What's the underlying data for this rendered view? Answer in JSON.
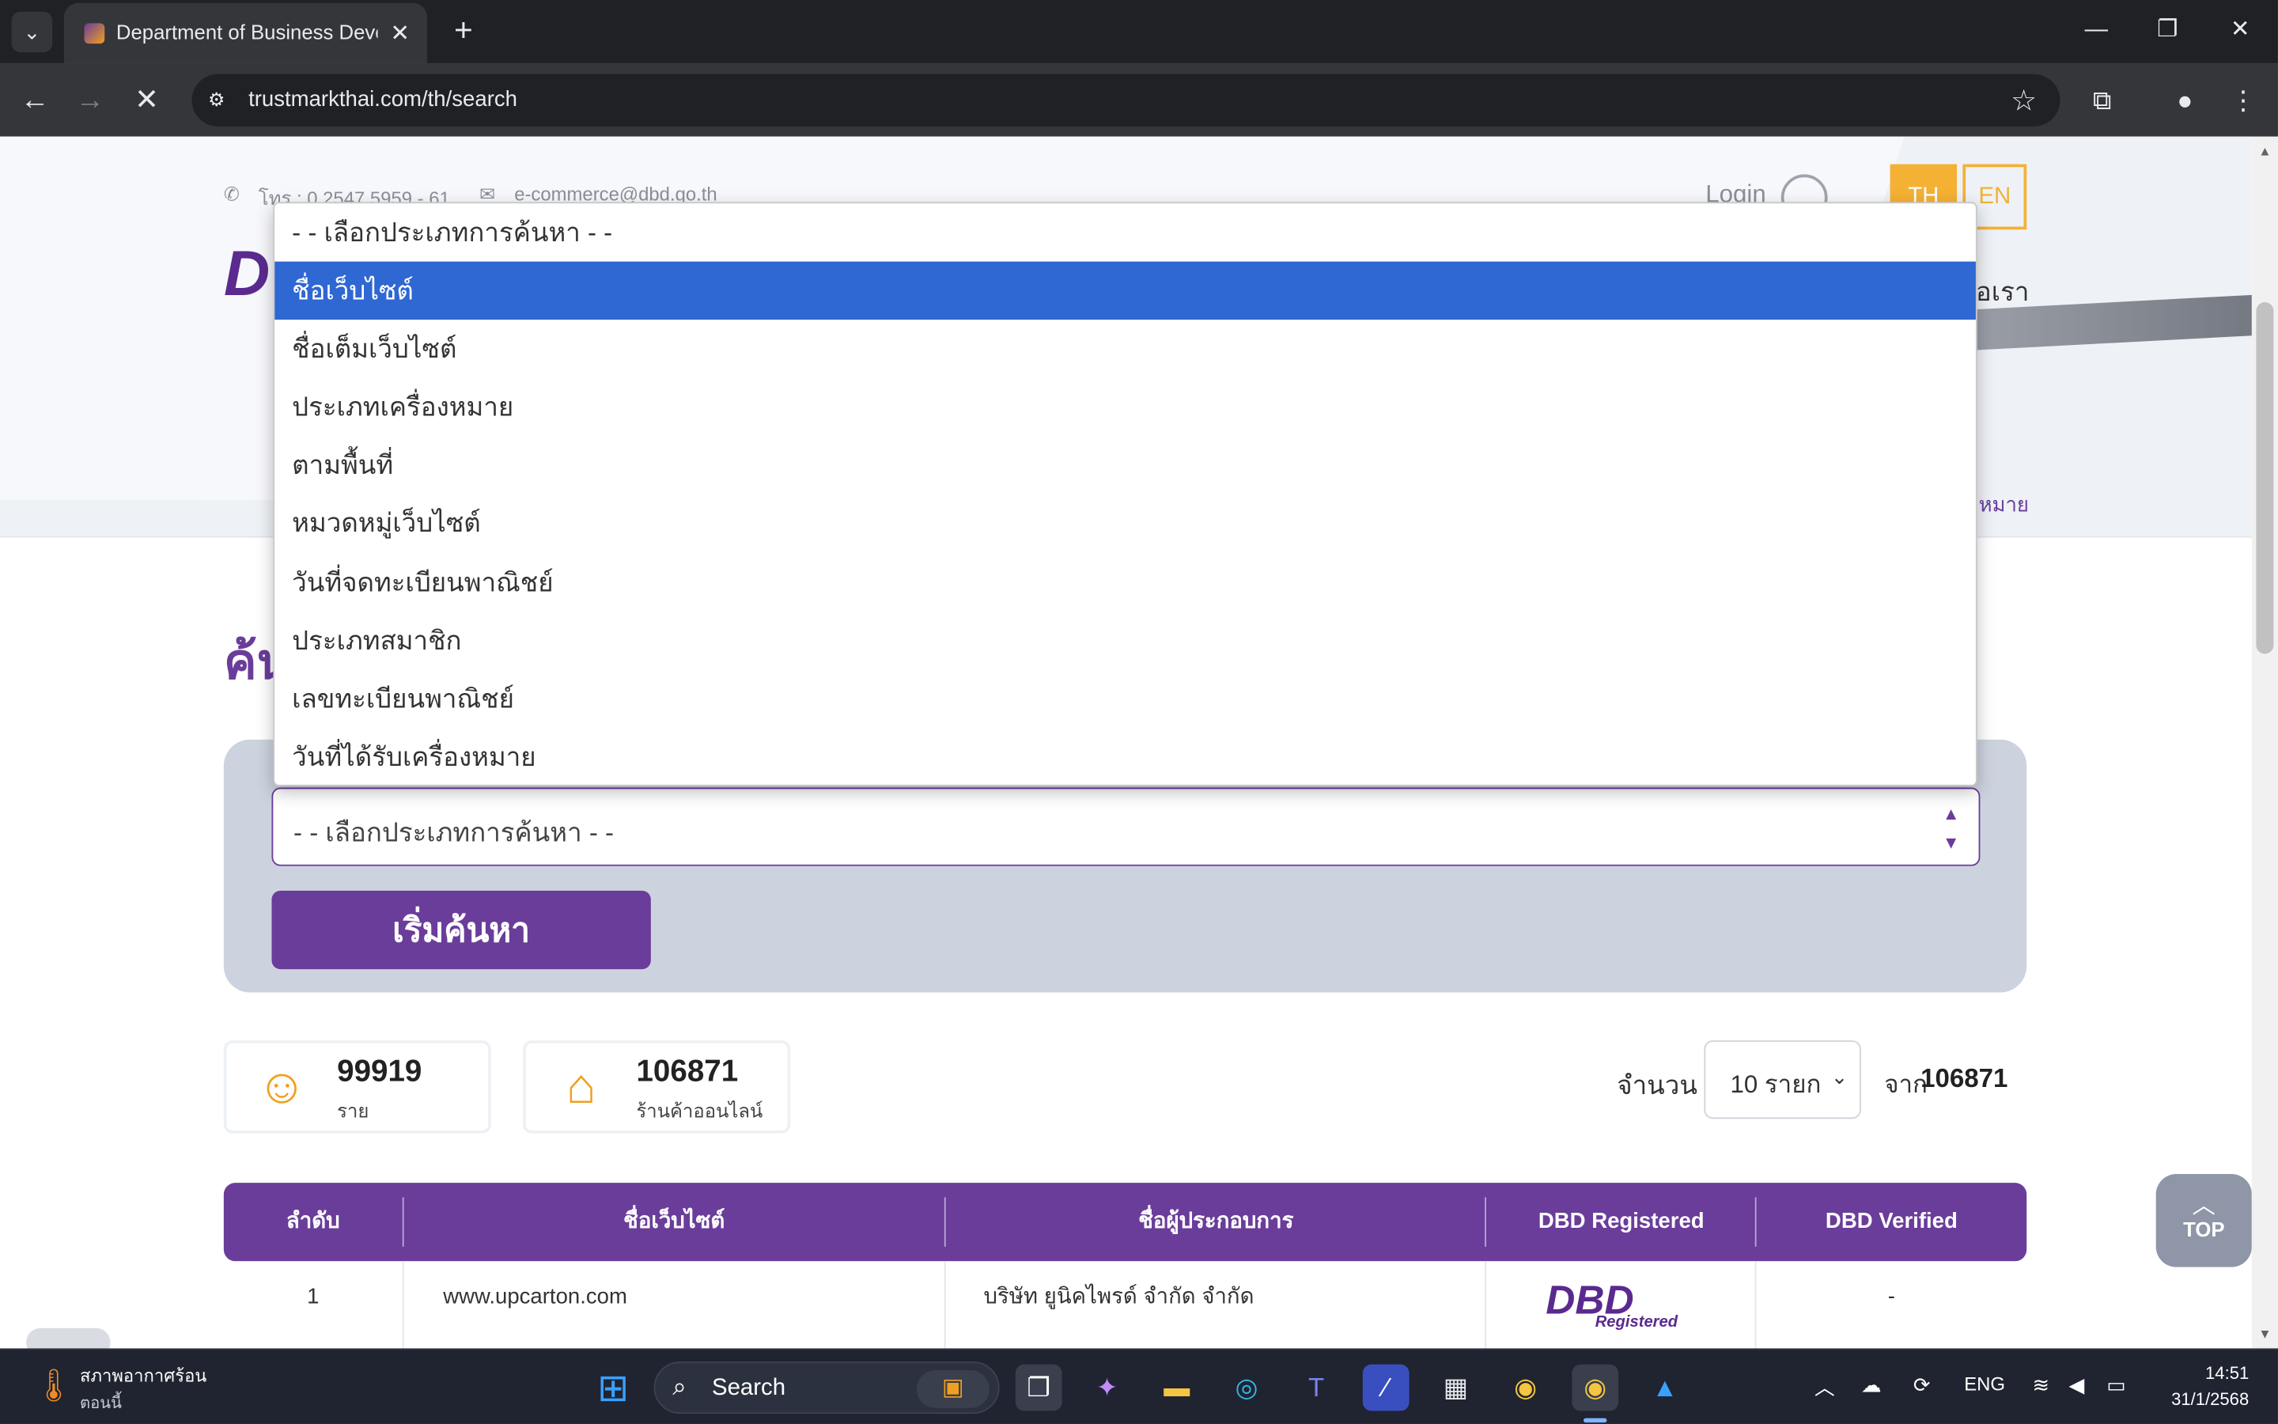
{
  "browser": {
    "tab_title": "Department of Business Develo",
    "new_tab_symbol": "+",
    "url": "trustmarkthai.com/th/search"
  },
  "header": {
    "phone": "โทร : 0 2547 5959 - 61",
    "email": "e-commerce@dbd.go.th",
    "login": "Login",
    "lang_th": "TH",
    "lang_en": "EN",
    "logo_fragment": "D",
    "menu_fragment": "อเรา",
    "breadcrumb_fragment": "หมาย"
  },
  "search": {
    "heading_fragment": "ค้น",
    "select_value": "- - เลือกประเภทการค้นหา - -",
    "button": "เริ่มค้นหา",
    "options": [
      "- - เลือกประเภทการค้นหา - -",
      "ชื่อเว็บไซต์",
      "ชื่อเต็มเว็บไซต์",
      "ประเภทเครื่องหมาย",
      "ตามพื้นที่",
      "หมวดหมู่เว็บไซต์",
      "วันที่จดทะเบียนพาณิชย์",
      "ประเภทสมาชิก",
      "เลขทะเบียนพาณิชย์",
      "วันที่ได้รับเครื่องหมาย"
    ],
    "highlighted_index": 1
  },
  "stats": {
    "members_value": "99919",
    "members_label": "ราย",
    "shops_value": "106871",
    "shops_label": "ร้านค้าออนไลน์"
  },
  "pagination": {
    "count_label": "จำนวน",
    "per_page": "10 รายก",
    "total_prefix": "จาก",
    "total": "106871"
  },
  "table": {
    "headers": [
      "ลำดับ",
      "ชื่อเว็บไซต์",
      "ชื่อผู้ประกอบการ",
      "DBD Registered",
      "DBD Verified"
    ],
    "rows": [
      {
        "index": "1",
        "website": "www.upcarton.com",
        "operator": "บริษัท ยูนิคไพรด์ จำกัด จำกัด",
        "registered_badge": "DBD",
        "registered_sub": "Registered",
        "verified": "-"
      }
    ]
  },
  "top_button": "TOP",
  "taskbar": {
    "weather_title": "สภาพอากาศร้อน",
    "weather_sub": "ตอนนี้",
    "search_placeholder": "Search",
    "lang": "ENG",
    "time": "14:51",
    "date": "31/1/2568"
  }
}
